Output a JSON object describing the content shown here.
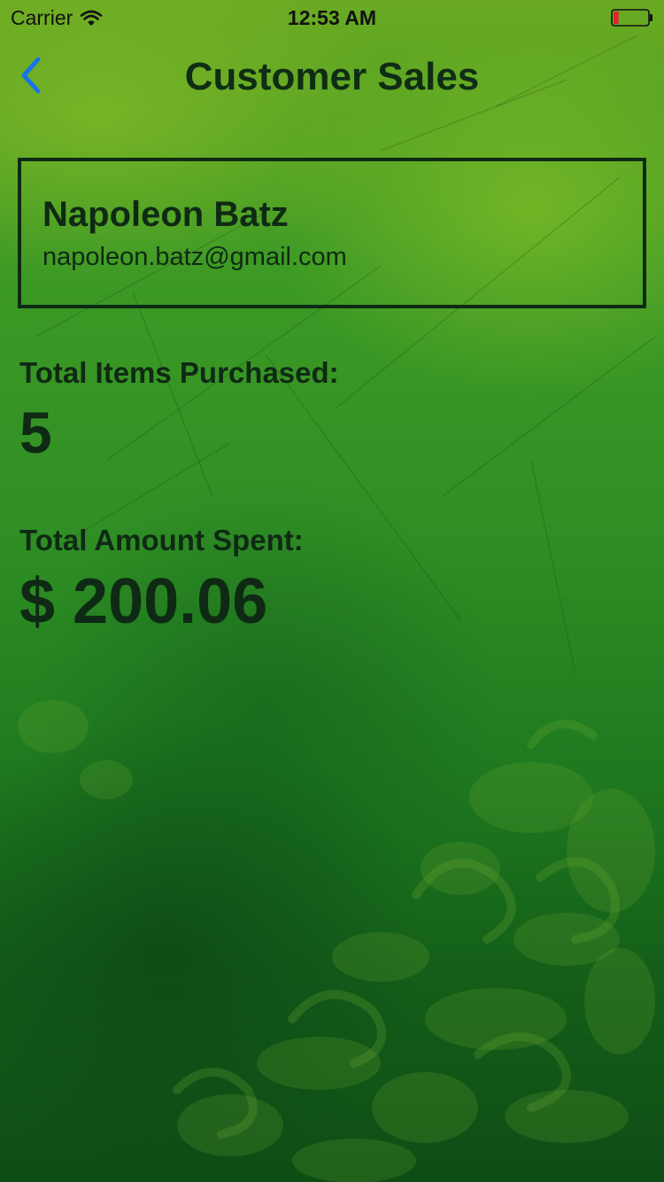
{
  "status_bar": {
    "carrier": "Carrier",
    "time": "12:53 AM",
    "battery_level": 0.15,
    "battery_color": "#e0262a"
  },
  "nav": {
    "title": "Customer Sales",
    "back_icon": "chevron-left-icon",
    "accent_color": "#1a73e8"
  },
  "customer": {
    "name": "Napoleon Batz",
    "email": "napoleon.batz@gmail.com"
  },
  "stats": {
    "items_label": "Total Items Purchased:",
    "items_value": "5",
    "amount_label": "Total Amount Spent:",
    "amount_value": "$ 200.06"
  }
}
